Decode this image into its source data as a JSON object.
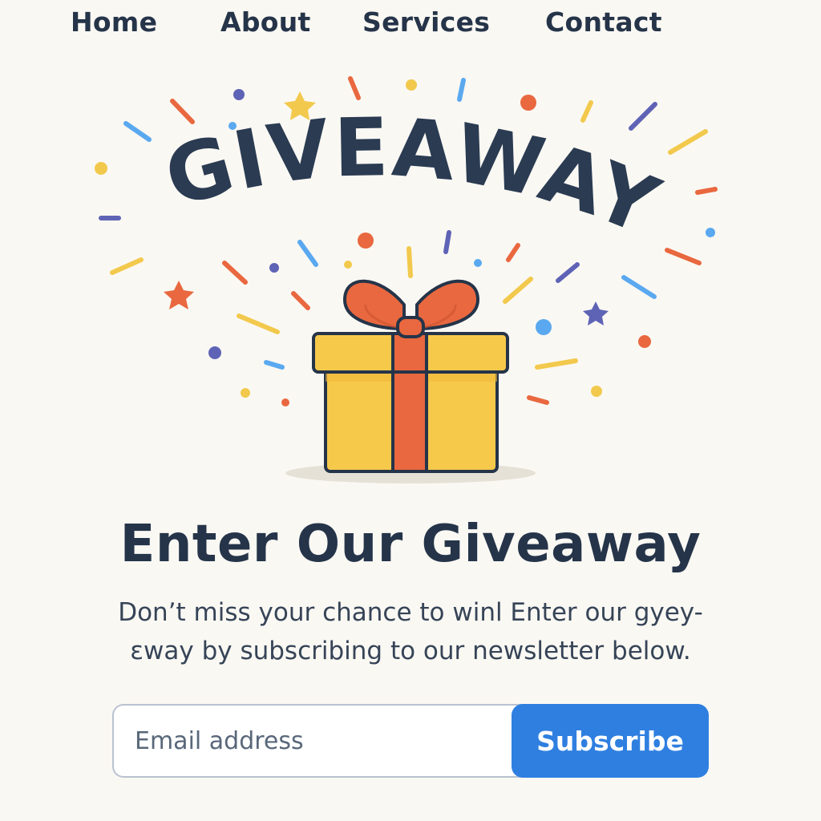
{
  "nav": {
    "items": [
      {
        "label": "Home"
      },
      {
        "label": "About"
      },
      {
        "label": "Services"
      },
      {
        "label": "Contact"
      }
    ]
  },
  "hero": {
    "banner_text": "GIVEAWAY",
    "illustration": "gift-box-icon",
    "colors": {
      "text": "#2a3b52",
      "box": "#f7c94b",
      "ribbon": "#e9683f",
      "outline": "#253449",
      "confetti": [
        "#f2c94c",
        "#e9683f",
        "#5e63b6",
        "#5aa9f0"
      ]
    }
  },
  "headline": "Enter Our Giveaway",
  "subtext": {
    "line1": "Don’t miss your chance to winl Enter our gyey-",
    "line2": "ɛway by subscribing to our newsletter below."
  },
  "form": {
    "email_placeholder": "Email address",
    "email_value": "",
    "subscribe_label": "Subscribe"
  },
  "colors": {
    "background": "#faf8f3",
    "primary_text": "#253449",
    "accent": "#2f7fe0"
  }
}
